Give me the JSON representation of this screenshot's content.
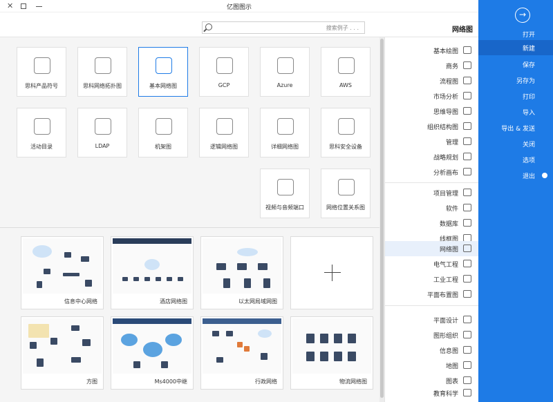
{
  "window": {
    "title": "亿图图示"
  },
  "header": {
    "search_placeholder": "搜索例子 . . .",
    "section_title": "网络图"
  },
  "sidebar": {
    "back_icon": "back-arrow-icon",
    "items": [
      {
        "label": "打开"
      },
      {
        "label": "新建"
      },
      {
        "label": "保存"
      },
      {
        "label": "另存为"
      },
      {
        "label": "打印"
      },
      {
        "label": "导入"
      },
      {
        "label": "导出 & 发送"
      },
      {
        "label": "关闭"
      },
      {
        "label": "选项"
      },
      {
        "label": "退出"
      }
    ]
  },
  "categories": {
    "group1": [
      {
        "label": "基本绘图",
        "icon": "shape-icon"
      },
      {
        "label": "商务",
        "icon": "briefcase-icon"
      },
      {
        "label": "流程图",
        "icon": "flowchart-icon"
      },
      {
        "label": "市场分析",
        "icon": "market-icon"
      },
      {
        "label": "思维导图",
        "icon": "mindmap-icon"
      },
      {
        "label": "组织结构图",
        "icon": "org-icon"
      },
      {
        "label": "管理",
        "icon": "manage-icon"
      },
      {
        "label": "战略规划",
        "icon": "strategy-icon"
      },
      {
        "label": "分析画布",
        "icon": "canvas-icon"
      }
    ],
    "group2": [
      {
        "label": "项目管理",
        "icon": "project-icon"
      },
      {
        "label": "软件",
        "icon": "software-icon"
      },
      {
        "label": "数据库",
        "icon": "database-icon"
      },
      {
        "label": "线框图",
        "icon": "wireframe-icon"
      },
      {
        "label": "网络图",
        "icon": "network-icon"
      },
      {
        "label": "电气工程",
        "icon": "electric-icon"
      },
      {
        "label": "工业工程",
        "icon": "industry-icon"
      },
      {
        "label": "平面布置图",
        "icon": "floorplan-icon"
      }
    ],
    "group3": [
      {
        "label": "平面设计",
        "icon": "design-icon"
      },
      {
        "label": "图形组织",
        "icon": "graphic-icon"
      },
      {
        "label": "信息图",
        "icon": "infographic-icon"
      },
      {
        "label": "地图",
        "icon": "map-icon"
      },
      {
        "label": "图表",
        "icon": "chart-icon"
      },
      {
        "label": "教育科学",
        "icon": "science-icon"
      }
    ]
  },
  "template_types": [
    {
      "label": "AWS",
      "icon": "aws-cloud-icon"
    },
    {
      "label": "Azure",
      "icon": "azure-cloud-icon"
    },
    {
      "label": "GCP",
      "icon": "gcp-hexagon-icon"
    },
    {
      "label": "基本网络图",
      "icon": "basic-network-icon"
    },
    {
      "label": "思科网络拓扑图",
      "icon": "cisco-topology-icon"
    },
    {
      "label": "思科产品符号",
      "icon": "cisco-product-icon"
    },
    {
      "label": "思科安全设备",
      "icon": "cisco-security-icon"
    },
    {
      "label": "详细网络图",
      "icon": "detailed-network-icon"
    },
    {
      "label": "逻辑网络图",
      "icon": "logical-network-icon"
    },
    {
      "label": "机架图",
      "icon": "rack-icon"
    },
    {
      "label": "LDAP",
      "icon": "ldap-icon"
    },
    {
      "label": "活动目录",
      "icon": "active-directory-icon"
    },
    {
      "label": "网络位置关系图",
      "icon": "network-location-icon"
    },
    {
      "label": "视频与音频端口",
      "icon": "av-port-icon"
    }
  ],
  "examples": [
    {
      "caption": ""
    },
    {
      "caption": "以太网局域网图"
    },
    {
      "caption": "酒店网络图"
    },
    {
      "caption": "信息中心网络"
    },
    {
      "caption": "物流网络图"
    },
    {
      "caption": "行政网络"
    },
    {
      "caption": "Ms4000中继"
    },
    {
      "caption": "方图"
    }
  ]
}
